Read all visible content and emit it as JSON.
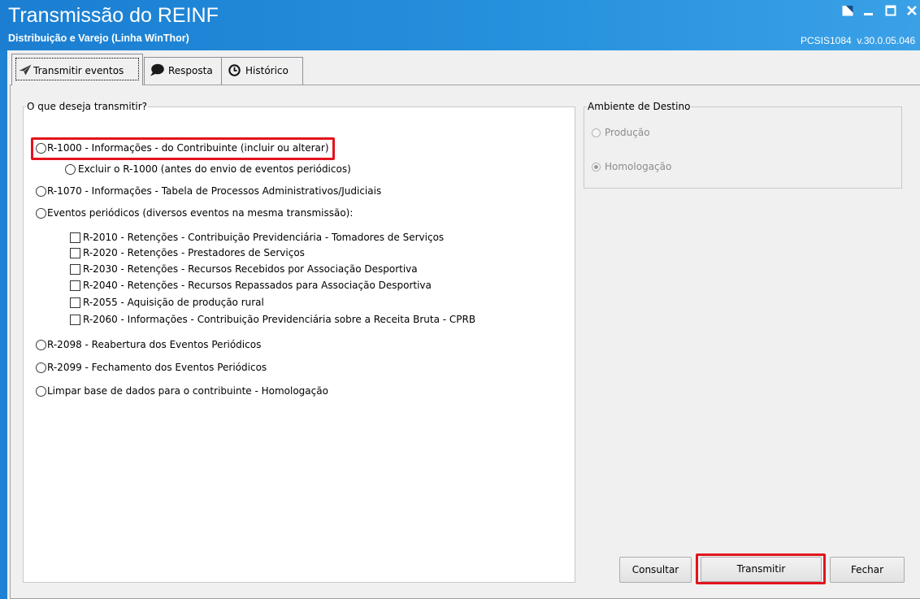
{
  "window": {
    "title": "Transmissão do REINF",
    "subtitle": "Distribuição e Varejo (Linha WinThor)",
    "version": "PCSIS1084  v.30.0.05.046",
    "controls": [
      "window-mode-icon",
      "minimize-icon",
      "maximize-icon",
      "close-icon"
    ]
  },
  "tabs": [
    {
      "label": "Transmitir eventos",
      "icon": "paper-plane-icon",
      "selected": true
    },
    {
      "label": "Resposta",
      "icon": "speech-bubble-icon",
      "selected": false
    },
    {
      "label": "Histórico",
      "icon": "clock-icon",
      "selected": false
    }
  ],
  "transmit": {
    "legend": "O que deseja transmitir?",
    "r1000": {
      "label": "R-1000 - Informações - do Contribuinte (incluir ou alterar)",
      "checked": false,
      "highlighted": true
    },
    "r1000_delete": {
      "label": "Excluir o R-1000 (antes do envio de eventos periódicos)",
      "checked": false
    },
    "r1070": {
      "label": "R-1070 - Informações - Tabela de Processos Administrativos/Judiciais",
      "checked": false
    },
    "periodic": {
      "label": "Eventos periódicos (diversos eventos na mesma transmissão):",
      "checked": false
    },
    "periodic_events": [
      {
        "label": "R-2010 - Retenções - Contribuição Previdenciária - Tomadores de Serviços",
        "checked": false
      },
      {
        "label": "R-2020 - Retenções - Prestadores de Serviços",
        "checked": false
      },
      {
        "label": "R-2030 - Retenções - Recursos Recebidos por Associação Desportiva",
        "checked": false
      },
      {
        "label": "R-2040 - Retenções - Recursos Repassados para Associação Desportiva",
        "checked": false
      },
      {
        "label": "R-2055 - Aquisição de produção rural",
        "checked": false
      },
      {
        "label": "R-2060 - Informações - Contribuição Previdenciária sobre a Receita Bruta - CPRB",
        "checked": false
      }
    ],
    "r2098": {
      "label": "R-2098 - Reabertura dos Eventos Periódicos",
      "checked": false
    },
    "r2099": {
      "label": "R-2099 - Fechamento dos Eventos Periódicos",
      "checked": false
    },
    "clear": {
      "label": "Limpar base de dados para o contribuinte - Homologação",
      "checked": false
    }
  },
  "environment": {
    "legend": "Ambiente de Destino",
    "enabled": false,
    "options": [
      {
        "label": "Produção",
        "checked": false
      },
      {
        "label": "Homologação",
        "checked": true
      }
    ]
  },
  "buttons": {
    "consultar": "Consultar",
    "transmitir": "Transmitir",
    "transmitir_highlighted": true,
    "fechar": "Fechar"
  },
  "colors": {
    "title_bar_start": "#1b7ed1",
    "title_bar_end": "#3aa1e7",
    "highlight": "#e2141c",
    "disabled_text": "#8c8c8c"
  }
}
